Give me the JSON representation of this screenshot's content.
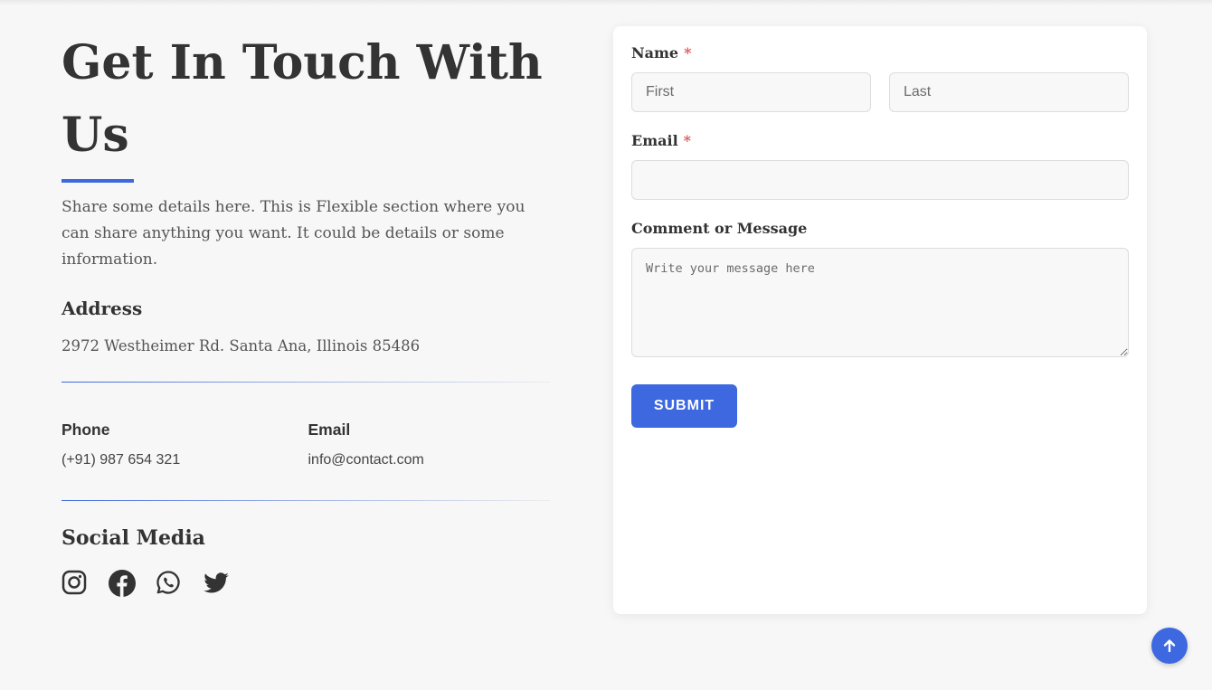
{
  "contact": {
    "title": "Get In Touch With Us",
    "intro": "Share some details here. This is Flexible section where you can share anything you want. It could be details or some information.",
    "address_heading": "Address",
    "address_value": "2972 Westheimer Rd. Santa Ana, Illinois 85486",
    "phone_heading": "Phone",
    "phone_value": "(+91) 987 654 321",
    "email_heading": "Email",
    "email_value": "info@contact.com",
    "social_heading": "Social Media",
    "social_icons": [
      "instagram-icon",
      "facebook-icon",
      "whatsapp-icon",
      "twitter-icon"
    ]
  },
  "form": {
    "name_label": "Name",
    "required_mark": "*",
    "first_placeholder": "First",
    "last_placeholder": "Last",
    "email_label": "Email",
    "message_label": "Comment or Message",
    "message_placeholder": "Write your message here",
    "submit_label": "SUBMIT"
  },
  "colors": {
    "accent": "#3d68df",
    "required": "#e05a5a",
    "background": "#f7f7f7"
  }
}
